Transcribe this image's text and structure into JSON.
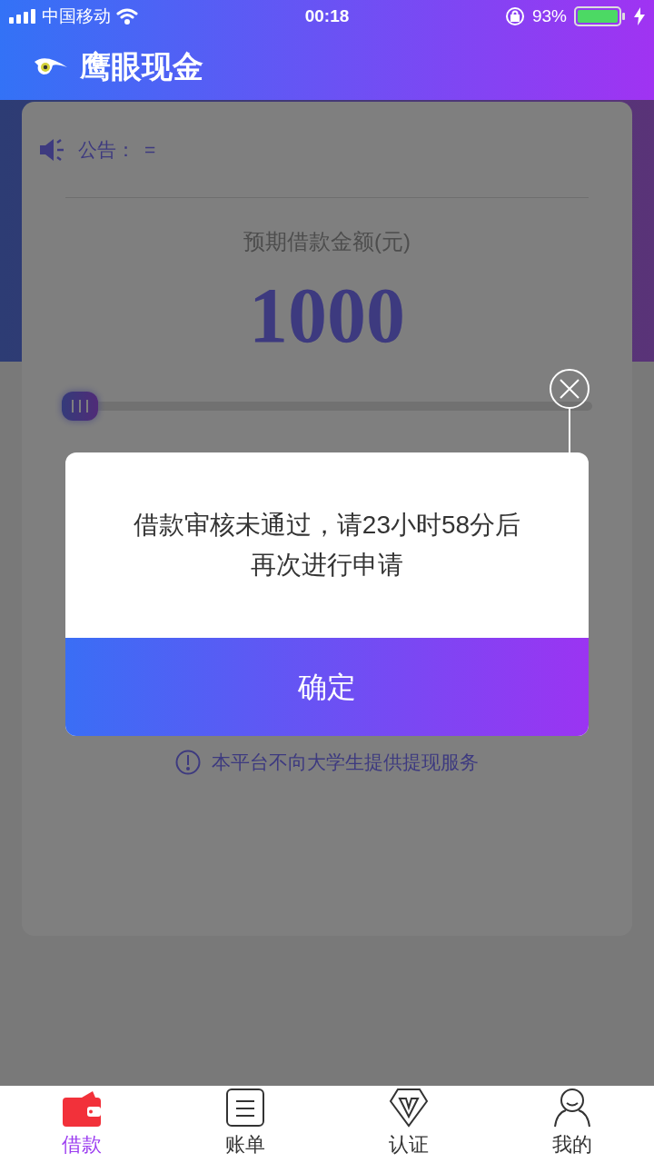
{
  "status_bar": {
    "carrier": "中国移动",
    "time": "00:18",
    "battery": "93%"
  },
  "header": {
    "title": "鹰眼现金"
  },
  "announcement": {
    "label": "公告：",
    "text": "="
  },
  "loan": {
    "label": "预期借款金额(元)",
    "amount": "1000",
    "slider": {
      "level": 0
    }
  },
  "notice": "本平台不向大学生提供提现服务",
  "dialog": {
    "message": "借款审核未通过，请23小时58分后再次进行申请",
    "button": "确定"
  },
  "tabs": [
    {
      "label": "借款",
      "selected": true
    },
    {
      "label": "账单",
      "selected": false
    },
    {
      "label": "认证",
      "selected": false
    },
    {
      "label": "我的",
      "selected": false
    }
  ]
}
